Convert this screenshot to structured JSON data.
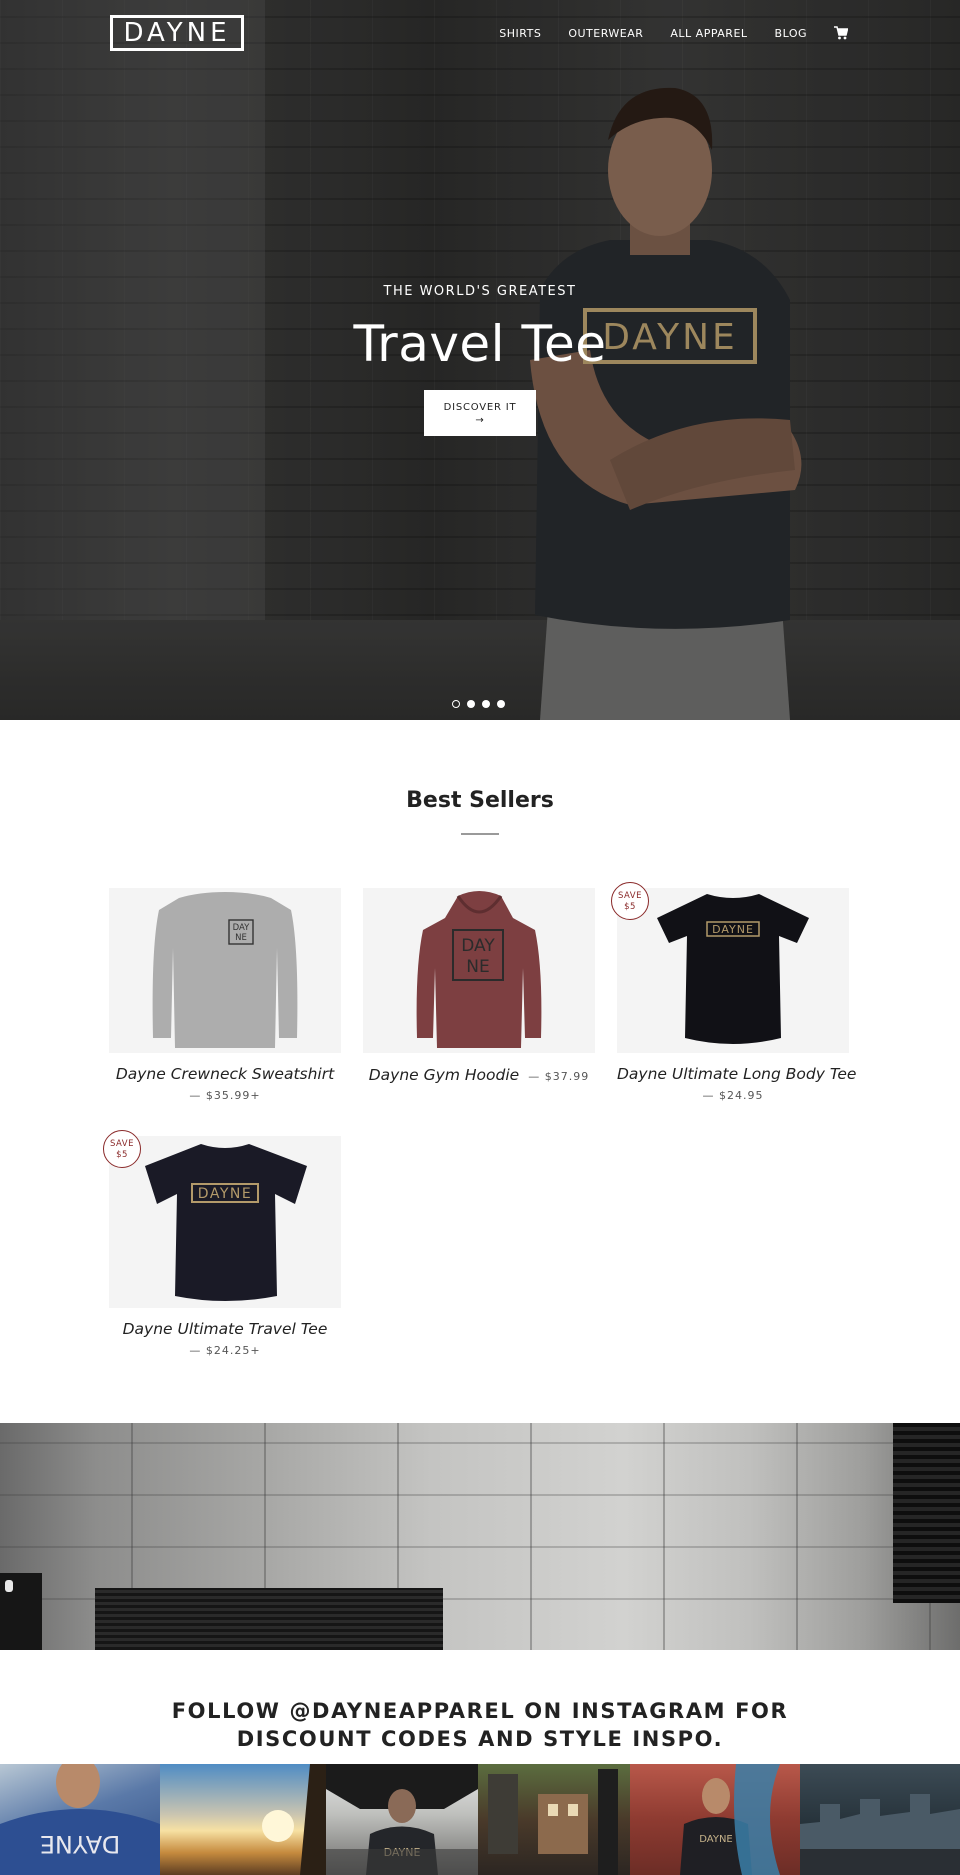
{
  "header": {
    "logo_text": "DAYNE",
    "nav": [
      {
        "label": "SHIRTS"
      },
      {
        "label": "OUTERWEAR"
      },
      {
        "label": "ALL APPAREL"
      },
      {
        "label": "BLOG"
      }
    ],
    "cart_icon": "cart-icon"
  },
  "hero": {
    "subtitle": "THE WORLD'S GREATEST",
    "title": "Travel Tee",
    "cta_label": "DISCOVER IT",
    "cta_arrow": "→",
    "shirt_print": "DAYNE",
    "slides_total": 4,
    "active_slide": 1
  },
  "best_sellers": {
    "title": "Best Sellers",
    "products": [
      {
        "name": "Dayne Crewneck Sweatshirt",
        "price": "— $35.99+",
        "badge": null,
        "print": "DAY NE"
      },
      {
        "name": "Dayne Gym Hoodie",
        "price": "— $37.99",
        "badge": null,
        "print": "DAY NE"
      },
      {
        "name": "Dayne Ultimate Long Body Tee",
        "price": "— $24.95",
        "badge": {
          "line1": "SAVE",
          "line2": "$5"
        },
        "print": "DAYNE"
      },
      {
        "name": "Dayne Ultimate Travel Tee",
        "price": "— $24.25+",
        "badge": {
          "line1": "SAVE",
          "line2": "$5"
        },
        "print": "DAYNE"
      }
    ]
  },
  "instagram": {
    "title_line1": "FOLLOW @DAYNEAPPAREL ON INSTAGRAM FOR",
    "title_line2": "DISCOUNT CODES AND STYLE INSPO.",
    "tile_print": "DAYNE"
  },
  "colors": {
    "badge": "#8a2a2a",
    "price": "#555555",
    "gold_print": "#b39a6a"
  }
}
